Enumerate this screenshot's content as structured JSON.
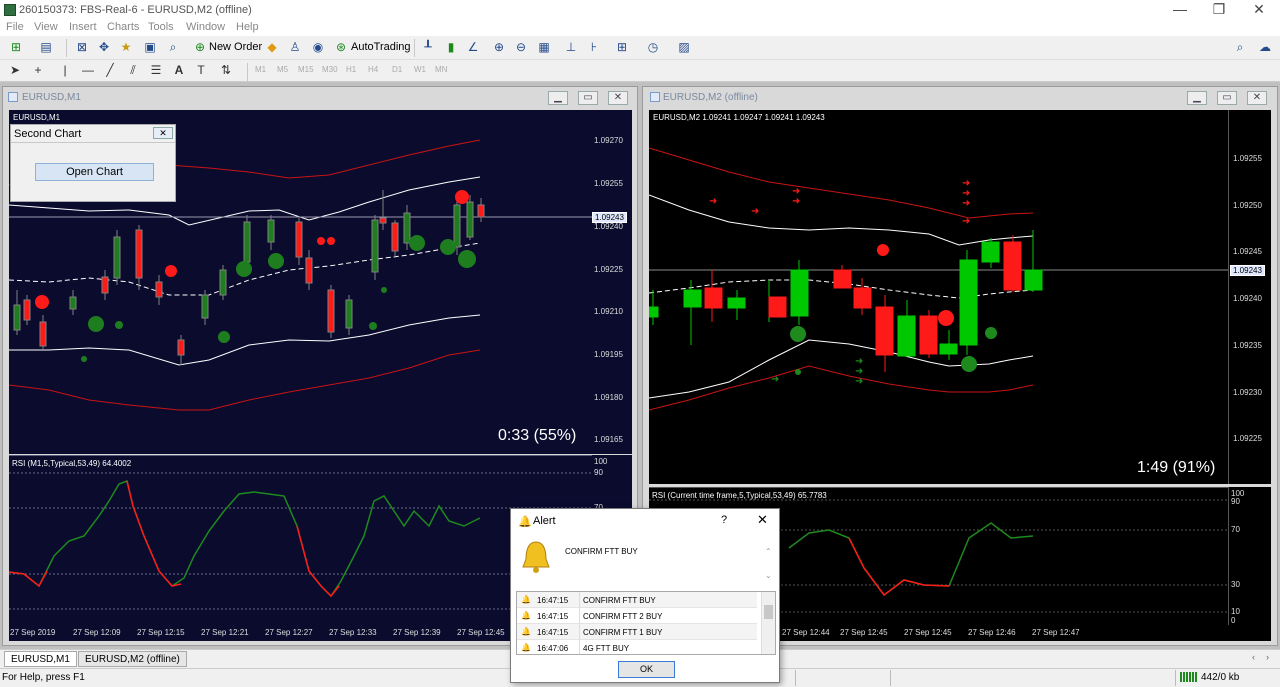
{
  "window": {
    "title": "260150373: FBS-Real-6 - EURUSD,M2 (offline)",
    "controls": [
      "—",
      "❐",
      "✕"
    ]
  },
  "menu": [
    "File",
    "View",
    "Insert",
    "Charts",
    "Tools",
    "Window",
    "Help"
  ],
  "toolbar": {
    "new_order": "New Order",
    "autotrading": "AutoTrading",
    "timeframes": [
      "M1",
      "M5",
      "M15",
      "M30",
      "H1",
      "H4",
      "D1",
      "W1",
      "MN"
    ]
  },
  "chart1": {
    "window_title": "EURUSD,M1",
    "pane_label": "EURUSD,M1",
    "price_labels": [
      "1.09270",
      "1.09255",
      "1.09240",
      "1.09225",
      "1.09210",
      "1.09195",
      "1.09180",
      "1.09165"
    ],
    "current_price": "1.09243",
    "timer": "0:33 (55%)",
    "rsi_label": "RSI (M1,5,Typical,53,49) 64.4002",
    "rsi_levels": [
      "100",
      "90",
      "70",
      "30",
      "10",
      "0"
    ],
    "time_labels": [
      "27 Sep 2019",
      "27 Sep 12:09",
      "27 Sep 12:15",
      "27 Sep 12:21",
      "27 Sep 12:27",
      "27 Sep 12:33",
      "27 Sep 12:39",
      "27 Sep 12:45"
    ]
  },
  "second_chart_dialog": {
    "title": "Second Chart",
    "button": "Open Chart"
  },
  "chart2": {
    "window_title": "EURUSD,M2 (offline)",
    "pane_label": "EURUSD,M2  1.09241 1.09247 1.09241 1.09243",
    "price_labels": [
      "1.09255",
      "1.09250",
      "1.09245",
      "1.09240",
      "1.09235",
      "1.09230",
      "1.09225"
    ],
    "current_price": "1.09243",
    "timer": "1:49 (91%)",
    "rsi_label": "RSI (Current time frame,5,Typical,53,49) 65.7783",
    "rsi_levels": [
      "100",
      "90",
      "70",
      "30",
      "10",
      "0"
    ],
    "time_labels": [
      "27 Sep 12:44",
      "27 Sep 12:45",
      "27 Sep 12:45",
      "27 Sep 12:46",
      "27 Sep 12:47"
    ]
  },
  "tabs": [
    "EURUSD,M1",
    "EURUSD,M2 (offline)"
  ],
  "status": {
    "help": "For Help, press F1",
    "traffic": "442/0 kb"
  },
  "alert": {
    "title": "Alert",
    "help": "?",
    "message": "CONFIRM FTT BUY",
    "rows": [
      {
        "time": "16:47:15",
        "text": "CONFIRM FTT BUY"
      },
      {
        "time": "16:47:15",
        "text": "CONFIRM FTT 2 BUY"
      },
      {
        "time": "16:47:15",
        "text": "CONFIRM FTT 1 BUY"
      },
      {
        "time": "16:47:06",
        "text": "4G FTT BUY"
      }
    ],
    "ok": "OK"
  },
  "colors": {
    "bull": "#00c800",
    "bull_dark": "#1e7d1e",
    "bear": "#ff1a1a",
    "band_outer": "#c81414",
    "band_inner": "#ffffff",
    "chart1_bg": "#0b0b2e",
    "chart2_bg": "#000000"
  }
}
